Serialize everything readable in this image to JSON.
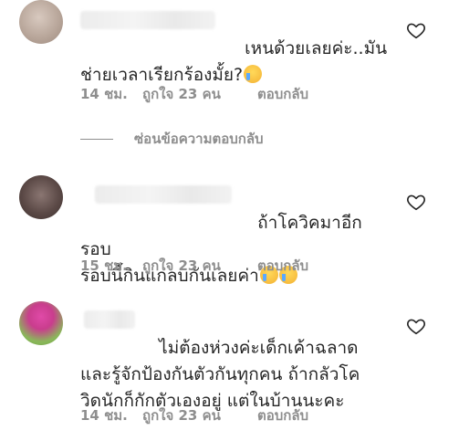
{
  "comments": [
    {
      "text_line1": "เหนด้วยเลยค่ะ..มัน",
      "text_line2": "ช่ายเวลาเรียกร้องมั้ย?",
      "emoji": "crying-face",
      "time": "14 ชม.",
      "likes": "ถูกใจ 23 คน",
      "reply": "ตอบกลับ"
    },
    {
      "text_line1": "ถ้าโควิคมาอีกรอบ",
      "text_line2": "รอบนี้กินแกลบกันเลยค่า",
      "emoji": "loudly-crying-face",
      "time": "15 ชม.",
      "likes": "ถูกใจ 23 คน",
      "reply": "ตอบกลับ"
    },
    {
      "text_line1": "ไม่ต้องห่วงค่ะเด็กเค้าฉลาด",
      "text_line2": "และรู้จักป้องกันตัวกันทุกคน ถ้ากลัวโค",
      "text_line3": "วิดนักก็กักตัวเองอยู่ แต่ในบ้านนะคะ",
      "time": "14 ชม.",
      "likes": "ถูกใจ 23 คน",
      "reply": "ตอบกลับ"
    }
  ],
  "hide_replies_label": "ซ่อนข้อความตอบกลับ",
  "colors": {
    "text": "#262626",
    "meta": "#8e8e8e",
    "background": "#ffffff"
  },
  "icons": {
    "like": "heart-outline-icon",
    "emoji_1": "crying-face-icon",
    "emoji_2": "loudly-crying-face-icon"
  }
}
